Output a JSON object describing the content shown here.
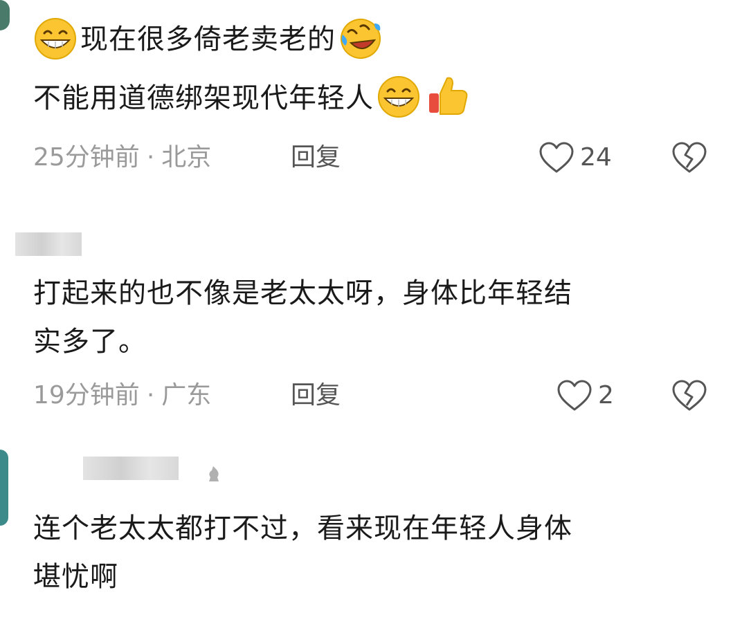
{
  "comments": [
    {
      "lines": [
        "现在很多倚老卖老的",
        "不能用道德绑架现代年轻人"
      ],
      "time": "25分钟前",
      "separator": "·",
      "location": "北京",
      "reply_label": "回复",
      "likes": "24",
      "emojis": [
        "grin-emoji",
        "laughing-crying-emoji",
        "grin-emoji",
        "thumbs-up-emoji"
      ]
    },
    {
      "lines": [
        "打起来的也不像是老太太呀，身体比年轻结",
        "实多了。"
      ],
      "time": "19分钟前",
      "separator": "·",
      "location": "广东",
      "reply_label": "回复",
      "likes": "2"
    },
    {
      "lines": [
        "连个老太太都打不过，看来现在年轻人身体",
        "堪忧啊"
      ]
    }
  ],
  "colors": {
    "meta_gray": "#9a9a9a",
    "text": "#1a1a1a",
    "icon": "#555555",
    "avatar_edge": "#4a7a6a"
  }
}
